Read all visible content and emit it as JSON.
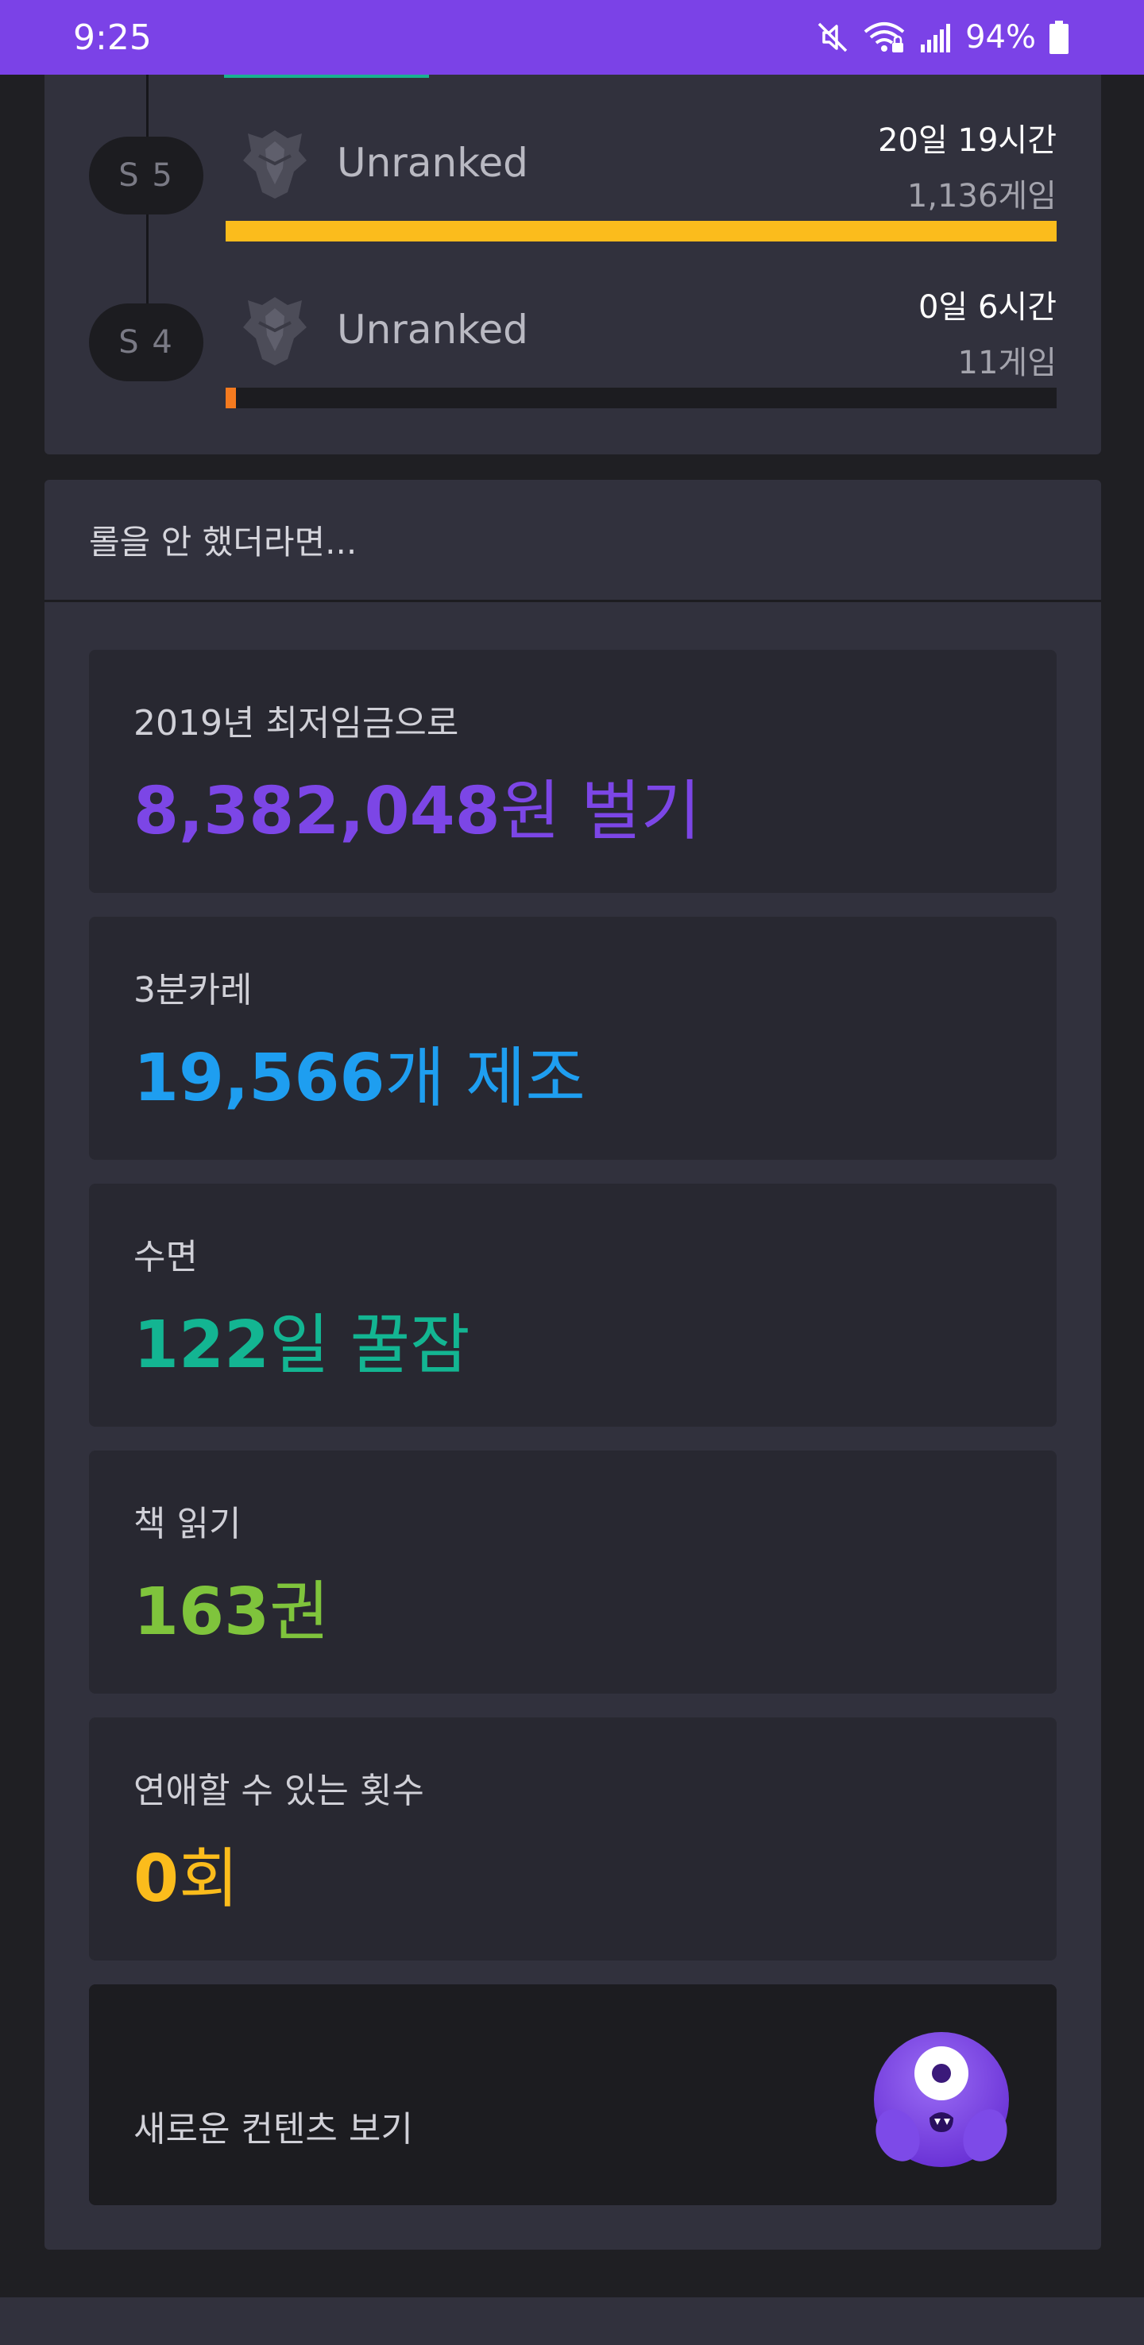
{
  "status_bar": {
    "time": "9:25",
    "battery": "94%",
    "icons": [
      "mute-icon",
      "wifi-icon",
      "signal-icon",
      "battery-icon"
    ],
    "background_color": "#7b42e7"
  },
  "seasons": [
    {
      "label": "S 5",
      "tier": "Unranked",
      "playtime": "20일 19시간",
      "games": "1,136게임",
      "bar_fraction": 1.0,
      "bar_color": "#fbbc1c"
    },
    {
      "label": "S 4",
      "tier": "Unranked",
      "playtime": "0일 6시간",
      "games": "11게임",
      "bar_fraction": 0.012,
      "bar_color": "#f47a1f"
    }
  ],
  "whatif": {
    "header": "롤을 안 했더라면...",
    "items": [
      {
        "label": "2019년 최저임금으로",
        "number": "8,382,048",
        "suffix": "원 벌기",
        "color": "#7c46e6"
      },
      {
        "label": "3분카레",
        "number": "19,566",
        "suffix": "개 제조",
        "color": "#1e9ef0"
      },
      {
        "label": "수면",
        "number": "122",
        "suffix": "일 꿀잠",
        "color": "#13b592"
      },
      {
        "label": "책 읽기",
        "number": "163",
        "suffix": "권",
        "color": "#7fc43c"
      },
      {
        "label": "연애할 수 있는 횟수",
        "number": "0",
        "suffix": "회",
        "color": "#fbbc1c"
      }
    ],
    "new_content_label": "새로운 컨텐츠 보기",
    "mascot_icon": "purple-monster-mascot-icon"
  }
}
